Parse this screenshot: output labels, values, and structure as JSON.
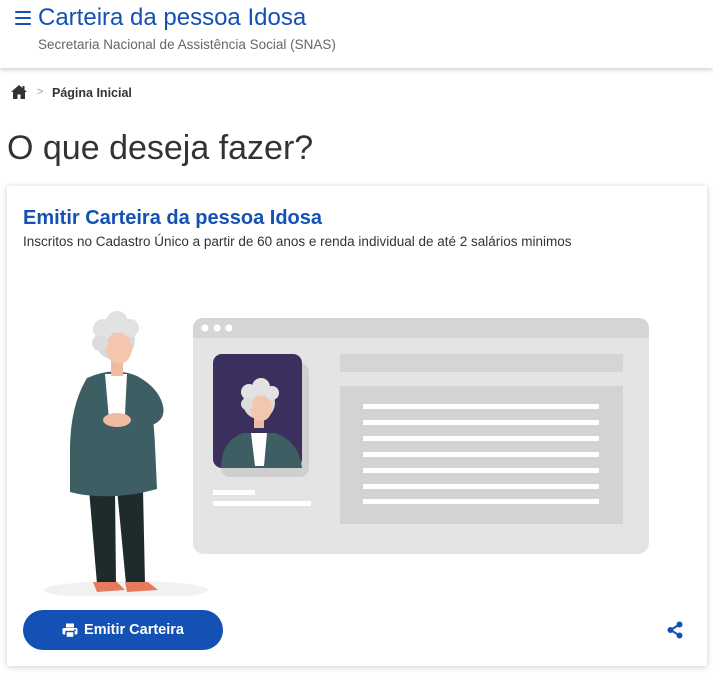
{
  "header": {
    "title": "Carteira da pessoa Idosa",
    "subtitle": "Secretaria Nacional de Assistência Social (SNAS)",
    "menu_icon": "hamburger-menu-icon"
  },
  "breadcrumb": {
    "home_icon": "home-icon",
    "separator": ">",
    "current": "Página Inicial"
  },
  "page": {
    "title": "O que deseja fazer?"
  },
  "card": {
    "title": "Emitir Carteira da pessoa Idosa",
    "description": "Inscritos no Cadastro Único a partir de 60 anos e renda individual de até 2 salários minimos",
    "button_label": "Emitir Carteira",
    "button_icon": "print-icon",
    "share_icon": "share-icon"
  },
  "colors": {
    "primary": "#1351b4",
    "text": "#333333",
    "muted": "#666666",
    "coat": "#3d5e62",
    "trousers": "#1e2b2d"
  }
}
